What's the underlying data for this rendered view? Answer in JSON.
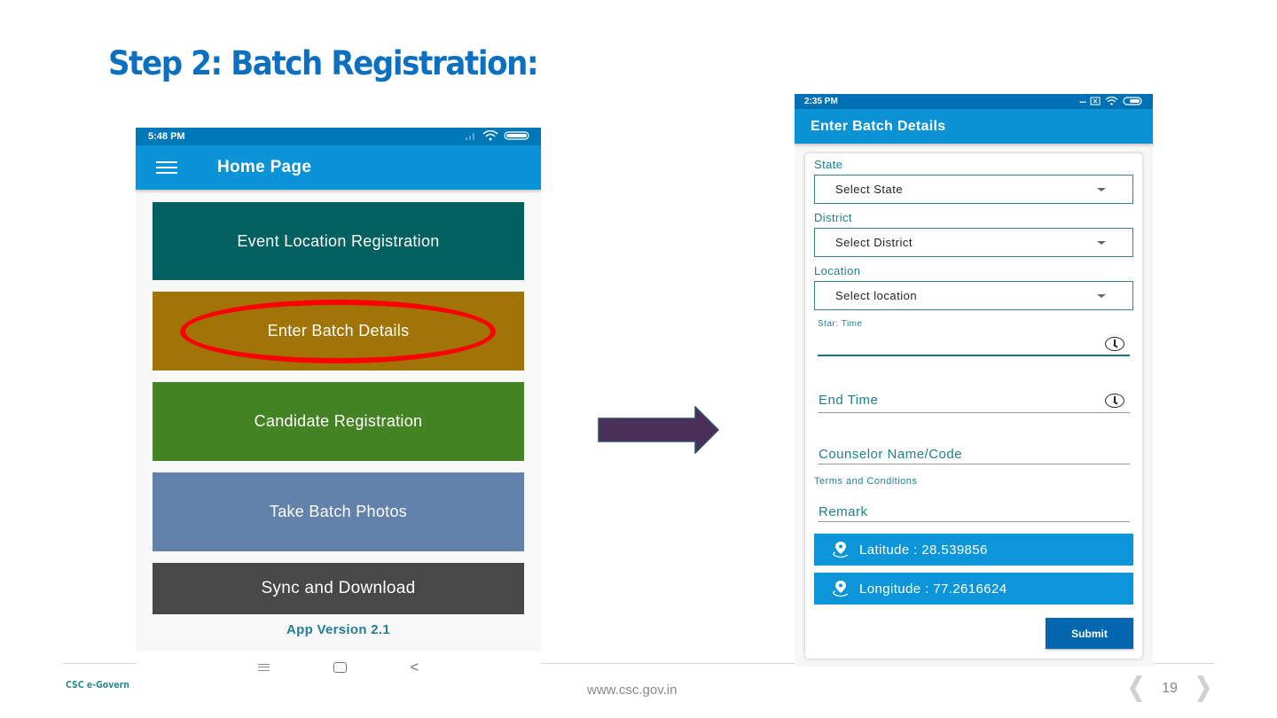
{
  "slide": {
    "title": "Step 2: Batch Registration:",
    "footer_org": "CSC e-Govern",
    "footer_url": "www.csc.gov.in",
    "page_number": "19"
  },
  "home_screen": {
    "status_time": "5:48 PM",
    "title": "Home Page",
    "buttons": [
      {
        "label": "Event Location Registration",
        "color": "#02605f"
      },
      {
        "label": "Enter Batch Details",
        "color": "#a07406",
        "highlighted": true
      },
      {
        "label": "Candidate Registration",
        "color": "#448324"
      },
      {
        "label": "Take Batch Photos",
        "color": "#6282ab"
      },
      {
        "label": "Sync and Download",
        "color": "#484848"
      }
    ],
    "app_version": "App Version 2.1",
    "highlight_color": "#ff0000"
  },
  "batch_screen": {
    "status_time": "2:35 PM",
    "title": "Enter Batch Details",
    "fields": {
      "state": {
        "label": "State",
        "value": "Select State"
      },
      "district": {
        "label": "District",
        "value": "Select District"
      },
      "location": {
        "label": "Location",
        "value": "Select location"
      },
      "start_time": {
        "label": "Star: Time"
      },
      "end_time": {
        "placeholder": "End Time"
      },
      "counselor": {
        "placeholder": "Counselor Name/Code"
      },
      "terms": {
        "label": "Terms and Conditions"
      },
      "remark": {
        "placeholder": "Remark"
      }
    },
    "latitude": "Latitude : 28.539856",
    "longitude": "Longitude : 77.2616624",
    "submit_label": "Submit"
  },
  "colors": {
    "title_blue": "#0d6fbf",
    "app_bar": "#0a92d5",
    "status_bar": "#0270b4",
    "teal_label": "#1f7f8c",
    "submit": "#0466ae",
    "arrow": "#4a3057"
  }
}
